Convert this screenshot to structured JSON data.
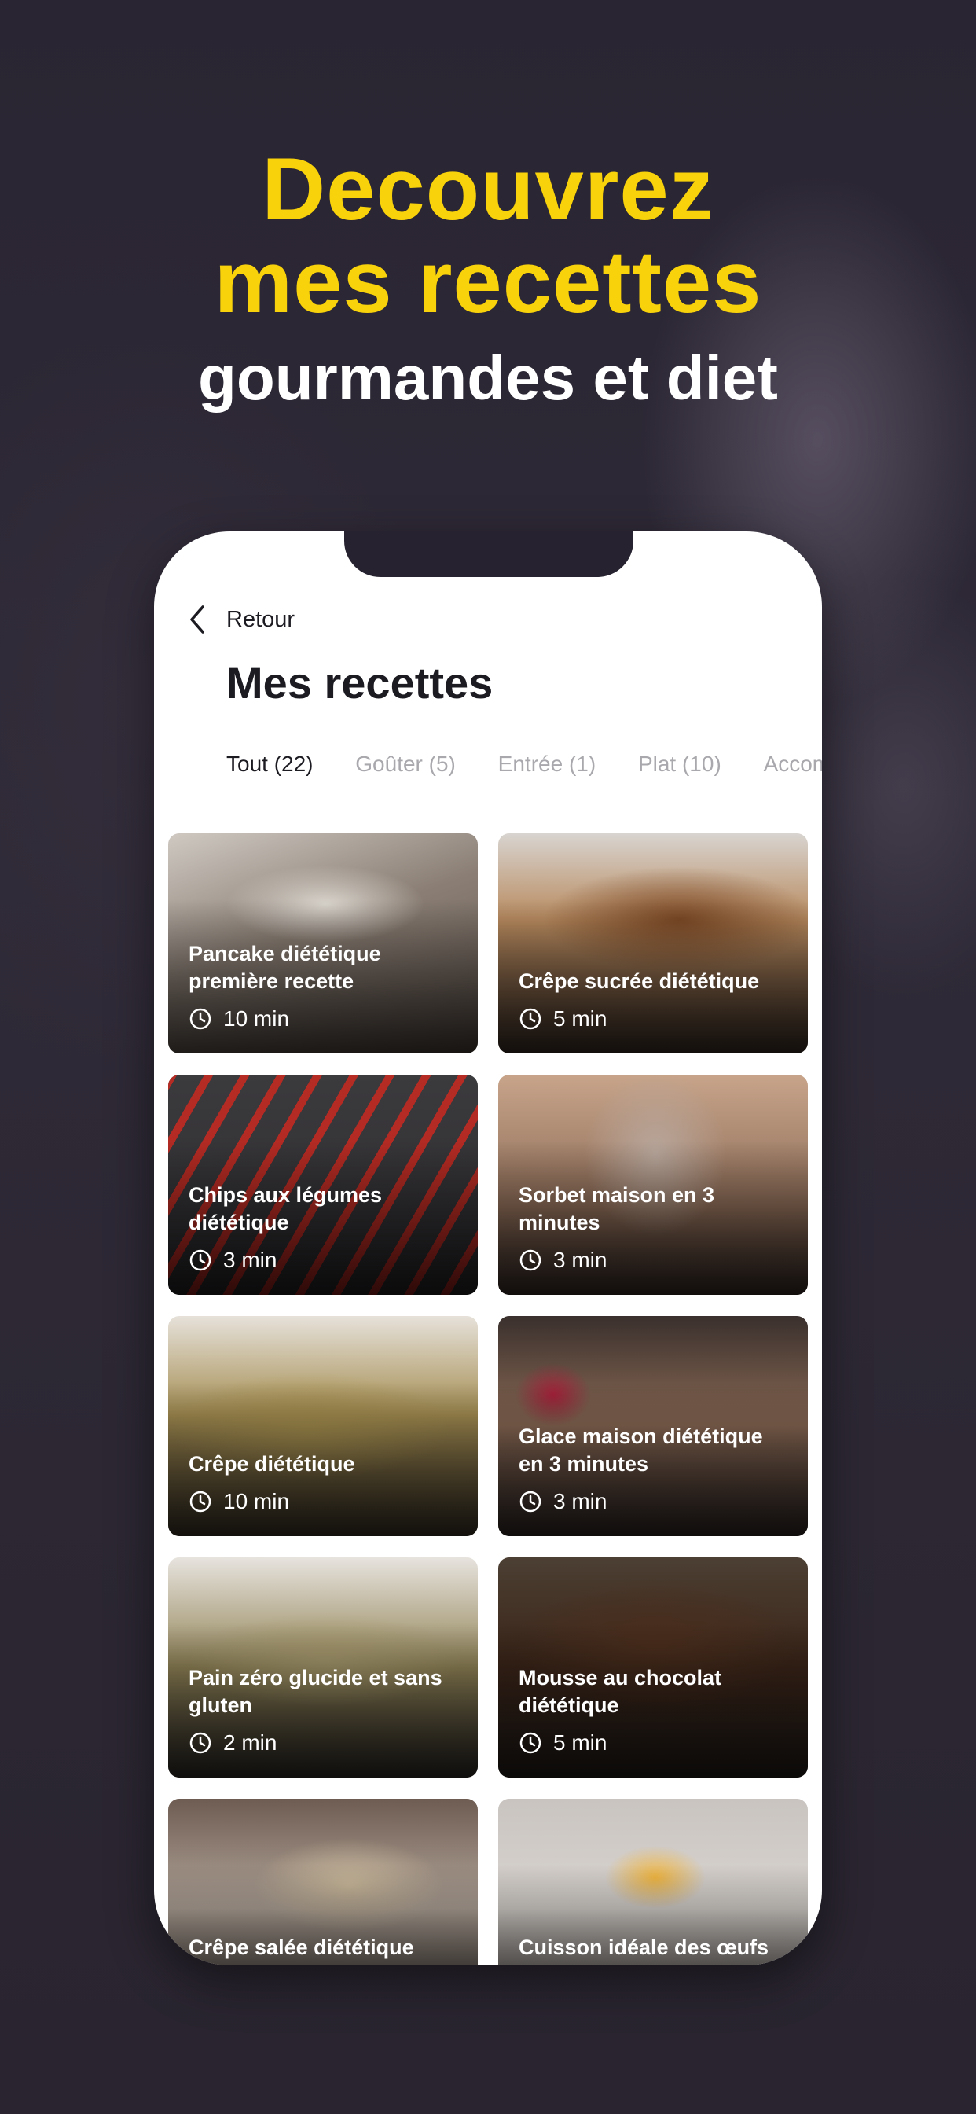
{
  "hero": {
    "line1": "Decouvrez",
    "line2": "mes recettes",
    "line3": "gourmandes et diet"
  },
  "screen": {
    "back_label": "Retour",
    "title": "Mes recettes",
    "tabs": [
      {
        "label": "Tout (22)",
        "active": true
      },
      {
        "label": "Goûter (5)",
        "active": false
      },
      {
        "label": "Entrée (1)",
        "active": false
      },
      {
        "label": "Plat (10)",
        "active": false
      },
      {
        "label": "Accom",
        "active": false
      }
    ],
    "recipes": [
      {
        "name": "Pancake diététique première recette",
        "time": "10 min"
      },
      {
        "name": "Crêpe sucrée diététique",
        "time": "5 min"
      },
      {
        "name": "Chips aux légumes diététique",
        "time": "3 min"
      },
      {
        "name": "Sorbet maison en 3 minutes",
        "time": "3 min"
      },
      {
        "name": "Crêpe diététique",
        "time": "10 min"
      },
      {
        "name": "Glace maison diététique en 3 minutes",
        "time": "3 min"
      },
      {
        "name": "Pain zéro glucide et sans gluten",
        "time": "2 min"
      },
      {
        "name": "Mousse au chocolat diététique",
        "time": "5 min"
      },
      {
        "name": "Crêpe salée diététique",
        "time": ""
      },
      {
        "name": "Cuisson idéale des œufs",
        "time": ""
      }
    ]
  },
  "colors": {
    "accent_yellow": "#f8d20a",
    "background": "#27222f",
    "text_dark": "#1d1b22",
    "tab_inactive": "#a8a8ad"
  },
  "icons": {
    "back": "chevron-left-icon",
    "time": "clock-icon"
  }
}
